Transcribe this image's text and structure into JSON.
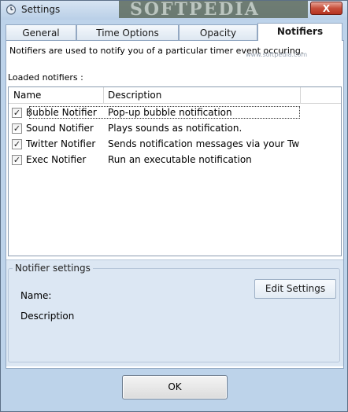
{
  "window": {
    "title": "Settings",
    "watermark": "SOFTPEDIA",
    "close_label": "X",
    "icon": "timer-icon"
  },
  "tabs": [
    {
      "label": "General",
      "active": false
    },
    {
      "label": "Time Options",
      "active": false
    },
    {
      "label": "Opacity",
      "active": false
    },
    {
      "label": "Notifiers",
      "active": true
    }
  ],
  "notifiers": {
    "intro": "Notifiers are used to notify you of a particular timer event occuring.",
    "loaded_label": "Loaded notifiers :",
    "softpedia_mark": "www.softpedia.com",
    "columns": [
      "Name",
      "Description"
    ],
    "rows": [
      {
        "checked": true,
        "name": "Bubble Notifier",
        "description": "Pop-up bubble notification"
      },
      {
        "checked": true,
        "name": "Sound Notifier",
        "description": "Plays sounds as notification."
      },
      {
        "checked": true,
        "name": "Twitter Notifier",
        "description": "Sends notification messages via your Twitte..."
      },
      {
        "checked": true,
        "name": "Exec Notifier",
        "description": "Run an executable notification"
      }
    ]
  },
  "notifier_settings": {
    "title": "Notifier settings",
    "name_label": "Name:",
    "description_label": "Description",
    "edit_button": "Edit Settings"
  },
  "footer": {
    "ok_label": "OK"
  },
  "colors": {
    "window_bg": "#bdd3ea",
    "close_red": "#c74f3b"
  }
}
